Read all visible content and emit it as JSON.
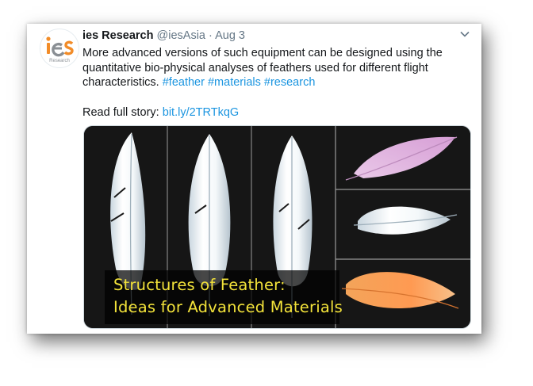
{
  "tweet": {
    "author_name": "ies Research",
    "handle": "@iesAsia",
    "separator": "·",
    "date": "Aug 3",
    "text_main": "More advanced versions of such equipment can be designed using the quantitative bio-physical analyses of feathers used for different flight characteristics.",
    "hashtags": [
      "#feather",
      "#materials",
      "#research"
    ],
    "read_label": "Read full story:",
    "link_text": "bit.ly/2TRTkqG"
  },
  "media": {
    "caption_line1": "Structures of Feather:",
    "caption_line2": "Ideas for Advanced Materials"
  },
  "avatar": {
    "logo_text": "ies",
    "logo_subtext": "Research"
  },
  "icons": {
    "menu": "chevron-down-icon"
  },
  "colors": {
    "link": "#1b95e0",
    "text": "#14171a",
    "muted": "#657786",
    "caption_text": "#f3e33a",
    "logo_orange": "#f28c28",
    "logo_gray": "#8a8f94"
  }
}
